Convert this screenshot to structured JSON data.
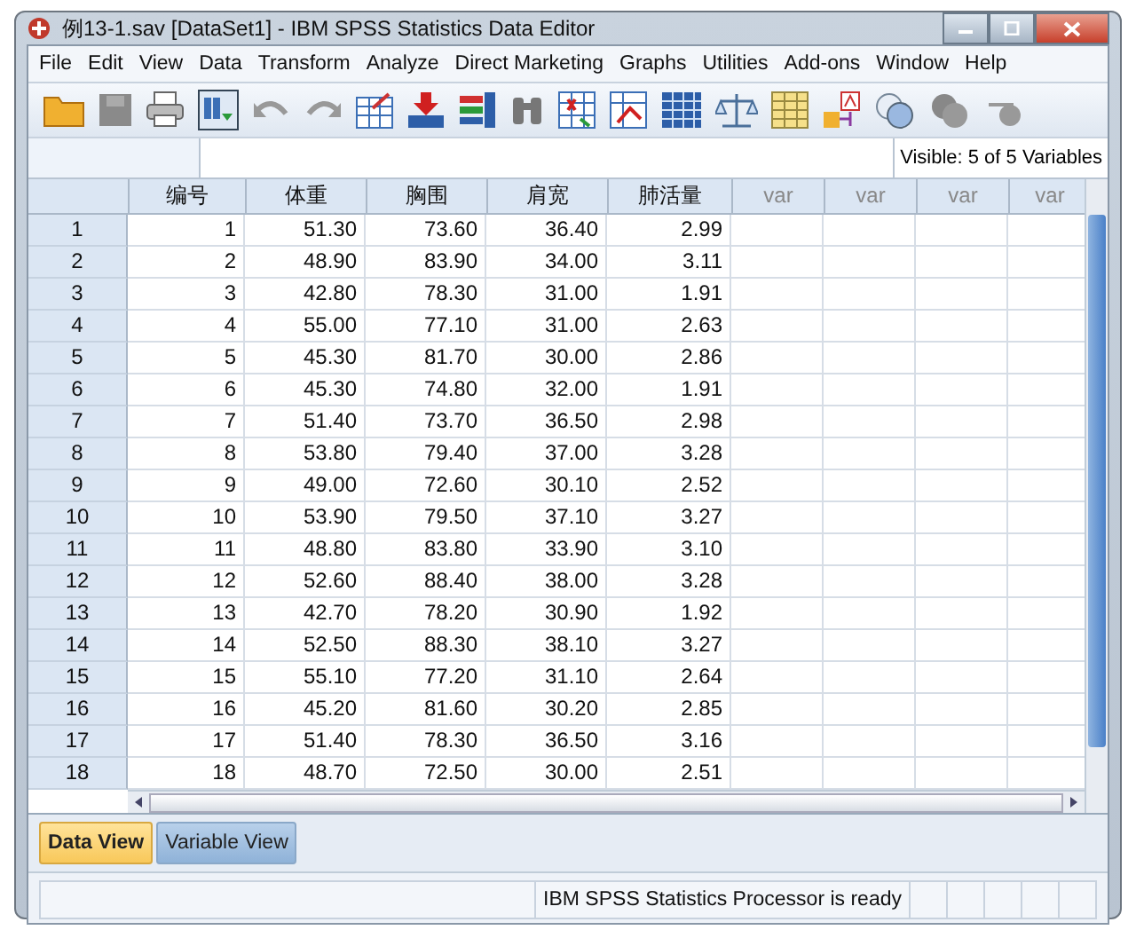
{
  "window": {
    "title": "例13-1.sav [DataSet1] - IBM SPSS Statistics Data Editor"
  },
  "menu": [
    "File",
    "Edit",
    "View",
    "Data",
    "Transform",
    "Analyze",
    "Direct Marketing",
    "Graphs",
    "Utilities",
    "Add-ons",
    "Window",
    "Help"
  ],
  "cell_editor": {
    "visible_info": "Visible: 5 of 5 Variables"
  },
  "table": {
    "columns": [
      "编号",
      "体重",
      "胸围",
      "肩宽",
      "肺活量",
      "var",
      "var",
      "var",
      "var"
    ],
    "rows": [
      {
        "label": "1",
        "cells": [
          "1",
          "51.30",
          "73.60",
          "36.40",
          "2.99"
        ]
      },
      {
        "label": "2",
        "cells": [
          "2",
          "48.90",
          "83.90",
          "34.00",
          "3.11"
        ]
      },
      {
        "label": "3",
        "cells": [
          "3",
          "42.80",
          "78.30",
          "31.00",
          "1.91"
        ]
      },
      {
        "label": "4",
        "cells": [
          "4",
          "55.00",
          "77.10",
          "31.00",
          "2.63"
        ]
      },
      {
        "label": "5",
        "cells": [
          "5",
          "45.30",
          "81.70",
          "30.00",
          "2.86"
        ]
      },
      {
        "label": "6",
        "cells": [
          "6",
          "45.30",
          "74.80",
          "32.00",
          "1.91"
        ]
      },
      {
        "label": "7",
        "cells": [
          "7",
          "51.40",
          "73.70",
          "36.50",
          "2.98"
        ]
      },
      {
        "label": "8",
        "cells": [
          "8",
          "53.80",
          "79.40",
          "37.00",
          "3.28"
        ]
      },
      {
        "label": "9",
        "cells": [
          "9",
          "49.00",
          "72.60",
          "30.10",
          "2.52"
        ]
      },
      {
        "label": "10",
        "cells": [
          "10",
          "53.90",
          "79.50",
          "37.10",
          "3.27"
        ]
      },
      {
        "label": "11",
        "cells": [
          "11",
          "48.80",
          "83.80",
          "33.90",
          "3.10"
        ]
      },
      {
        "label": "12",
        "cells": [
          "12",
          "52.60",
          "88.40",
          "38.00",
          "3.28"
        ]
      },
      {
        "label": "13",
        "cells": [
          "13",
          "42.70",
          "78.20",
          "30.90",
          "1.92"
        ]
      },
      {
        "label": "14",
        "cells": [
          "14",
          "52.50",
          "88.30",
          "38.10",
          "3.27"
        ]
      },
      {
        "label": "15",
        "cells": [
          "15",
          "55.10",
          "77.20",
          "31.10",
          "2.64"
        ]
      },
      {
        "label": "16",
        "cells": [
          "16",
          "45.20",
          "81.60",
          "30.20",
          "2.85"
        ]
      },
      {
        "label": "17",
        "cells": [
          "17",
          "51.40",
          "78.30",
          "36.50",
          "3.16"
        ]
      },
      {
        "label": "18",
        "cells": [
          "18",
          "48.70",
          "72.50",
          "30.00",
          "2.51"
        ]
      }
    ]
  },
  "view_tabs": [
    {
      "label": "Data View",
      "selected": true
    },
    {
      "label": "Variable View",
      "selected": false
    }
  ],
  "status_bar": "IBM SPSS Statistics Processor is ready"
}
